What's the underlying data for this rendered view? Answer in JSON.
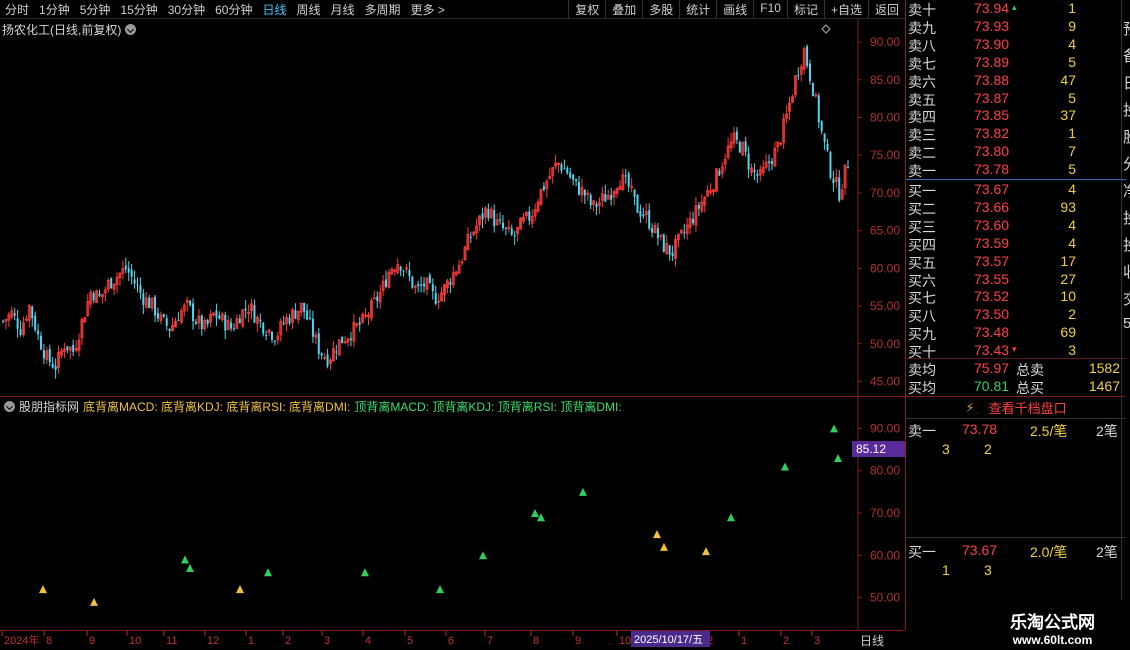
{
  "toolbar": {
    "periods": [
      "分时",
      "1分钟",
      "5分钟",
      "15分钟",
      "30分钟",
      "60分钟",
      "日线",
      "周线",
      "月线",
      "多周期",
      "更多 >"
    ],
    "active_period": "日线",
    "tools": [
      "复权",
      "叠加",
      "多股",
      "统计",
      "画线",
      "F10",
      "标记",
      "+自选",
      "返回"
    ]
  },
  "main_chart": {
    "title": "扬农化工(日线,前复权)",
    "y_ticks": [
      "90.00",
      "85.00",
      "80.00",
      "75.00",
      "70.00",
      "65.00",
      "60.00",
      "55.00",
      "50.00",
      "45.00"
    ]
  },
  "indicator": {
    "name": "股朋指标网",
    "legend_yellow": "底背离MACD: 底背离KDJ: 底背离RSI: 底背离DMI:",
    "legend_green": "顶背离MACD: 顶背离KDJ: 顶背离RSI: 顶背离DMI:",
    "y_ticks": [
      "90.00",
      "80.00",
      "70.00",
      "60.00",
      "50.00"
    ],
    "current_value": "85.12"
  },
  "date_axis": {
    "labels": [
      "2024年",
      "8",
      "9",
      "10",
      "11",
      "12",
      "1",
      "2",
      "3",
      "4",
      "5",
      "6",
      "7",
      "8",
      "9",
      "10",
      "11",
      "12",
      "1",
      "2",
      "3"
    ],
    "cursor_date": "2025/10/17/五",
    "period_label": "日线"
  },
  "orderbook": {
    "sell": [
      {
        "label": "卖十",
        "price": "73.94",
        "vol": "1"
      },
      {
        "label": "卖九",
        "price": "73.93",
        "vol": "9"
      },
      {
        "label": "卖八",
        "price": "73.90",
        "vol": "4"
      },
      {
        "label": "卖七",
        "price": "73.89",
        "vol": "5"
      },
      {
        "label": "卖六",
        "price": "73.88",
        "vol": "47"
      },
      {
        "label": "卖五",
        "price": "73.87",
        "vol": "5"
      },
      {
        "label": "卖四",
        "price": "73.85",
        "vol": "37"
      },
      {
        "label": "卖三",
        "price": "73.82",
        "vol": "1"
      },
      {
        "label": "卖二",
        "price": "73.80",
        "vol": "7"
      },
      {
        "label": "卖一",
        "price": "73.78",
        "vol": "5"
      }
    ],
    "buy": [
      {
        "label": "买一",
        "price": "73.67",
        "vol": "4"
      },
      {
        "label": "买二",
        "price": "73.66",
        "vol": "93"
      },
      {
        "label": "买三",
        "price": "73.60",
        "vol": "4"
      },
      {
        "label": "买四",
        "price": "73.59",
        "vol": "4"
      },
      {
        "label": "买五",
        "price": "73.57",
        "vol": "17"
      },
      {
        "label": "买六",
        "price": "73.55",
        "vol": "27"
      },
      {
        "label": "买七",
        "price": "73.52",
        "vol": "10"
      },
      {
        "label": "买八",
        "price": "73.50",
        "vol": "2"
      },
      {
        "label": "买九",
        "price": "73.48",
        "vol": "69"
      },
      {
        "label": "买十",
        "price": "73.43",
        "vol": "3"
      }
    ],
    "sell_avg_label": "卖均",
    "sell_avg": "75.97",
    "total_sell_label": "总卖",
    "total_sell": "1582",
    "buy_avg_label": "买均",
    "buy_avg": "70.81",
    "total_buy_label": "总买",
    "total_buy": "1467"
  },
  "qiandang": {
    "button": "查看千档盘口",
    "sell1": {
      "label": "卖一",
      "price": "73.78",
      "avg": "2.5/笔",
      "count": "2笔",
      "detail": [
        "3",
        "2"
      ]
    },
    "buy1": {
      "label": "买一",
      "price": "73.67",
      "avg": "2.0/笔",
      "count": "2笔",
      "detail": [
        "1",
        "3"
      ]
    }
  },
  "edge_text": [
    "预",
    "备",
    "日",
    "投",
    "股",
    "分",
    "净",
    "投",
    "投",
    "收",
    "交",
    "5"
  ],
  "watermark": {
    "title": "乐淘公式网",
    "url": "www.60lt.com"
  },
  "colors": {
    "up": "#ff3b3b",
    "down": "#4fd7f0",
    "bg": "#000000",
    "grid_red": "#8b1a1a"
  },
  "chart_data": {
    "type": "candlestick",
    "title": "扬农化工(日线,前复权)",
    "ylim": [
      44,
      92
    ],
    "close_path": [
      53,
      54,
      52,
      55,
      51,
      48,
      47,
      50,
      49,
      53,
      57,
      56,
      58,
      59,
      60,
      58,
      56,
      55,
      53,
      52,
      54,
      55,
      53,
      52,
      54,
      53,
      52,
      54,
      55,
      53,
      52,
      51,
      53,
      54,
      55,
      52,
      49,
      48,
      50,
      51,
      52,
      53,
      55,
      57,
      60,
      61,
      59,
      57,
      58,
      56,
      57,
      59,
      61,
      64,
      66,
      68,
      66,
      65,
      64,
      66,
      67,
      70,
      72,
      74,
      73,
      71,
      70,
      68,
      69,
      70,
      72,
      71,
      68,
      67,
      65,
      63,
      62,
      64,
      66,
      68,
      70,
      72,
      75,
      77,
      76,
      73,
      72,
      74,
      76,
      80,
      85,
      89,
      84,
      78,
      73,
      70,
      74
    ]
  }
}
